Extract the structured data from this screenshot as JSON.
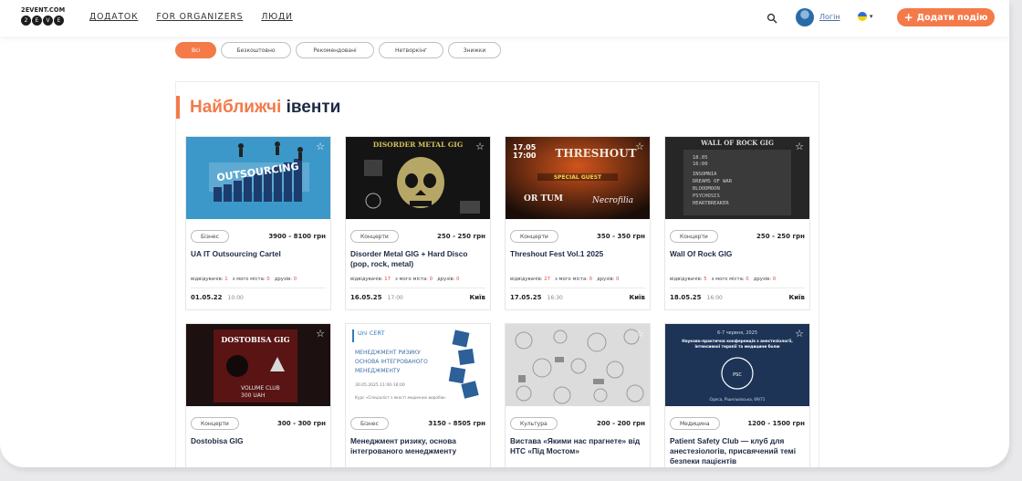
{
  "header": {
    "logo_text": "2EVENT.COM",
    "logo_dots": [
      "2",
      "E",
      "V",
      "E"
    ],
    "nav": [
      "ДОДАТОК",
      "FOR ORGANIZERS",
      "ЛЮДИ"
    ],
    "login": "Логін",
    "add_event": "Додати подію",
    "add_icon": "plus-icon"
  },
  "filters": [
    "Всі",
    "Безкоштовно",
    "Рекомендовані",
    "Нетворкінг",
    "Знижки"
  ],
  "section": {
    "title_highlight": "Найближчі",
    "title_rest": " івенти"
  },
  "stats_labels": {
    "attending": "відвідувачів:",
    "city": "з мого міста:",
    "friends": "друзів:"
  },
  "cards": [
    {
      "tag": "Бізнес",
      "price": "3900 - 8100 грн",
      "name": "UA IT Outsourcing Cartel",
      "attending": "1",
      "from_city": "0",
      "friends": "0",
      "date": "01.05.22",
      "time": "10:00",
      "city": "",
      "image_text": "OUTSOURCING",
      "image_bg": "#3b98c9"
    },
    {
      "tag": "Концерти",
      "price": "250 - 250 грн",
      "name": "Disorder Metal GIG + Hard Disco (pop, rock, metal)",
      "attending": "17",
      "from_city": "0",
      "friends": "0",
      "date": "16.05.25",
      "time": "17:00",
      "city": "Київ",
      "image_text": "DISORDER METAL GIG",
      "image_bg": "#141414"
    },
    {
      "tag": "Концерти",
      "price": "350 - 350 грн",
      "name": "Threshout Fest Vol.1 2025",
      "attending": "27",
      "from_city": "0",
      "friends": "0",
      "date": "17.05.25",
      "time": "16:30",
      "city": "Київ",
      "image_text": "THRESHOUT",
      "image_bg": "#2a1a14"
    },
    {
      "tag": "Концерти",
      "price": "250 - 250 грн",
      "name": "Wall Of Rock GIG",
      "attending": "5",
      "from_city": "0",
      "friends": "0",
      "date": "18.05.25",
      "time": "16:00",
      "city": "Київ",
      "image_text": "WALL OF ROCK GIG",
      "image_bg": "#262626"
    },
    {
      "tag": "Концерти",
      "price": "300 - 300 грн",
      "name": "Dostobisa GIG",
      "image_text": "DOSTOBISA GIG",
      "image_bg": "#1c1010"
    },
    {
      "tag": "Бізнес",
      "price": "3150 - 8505 грн",
      "name": "Менеджмент ризику, основа інтегрованого менеджменту",
      "image_text": "МЕНЕДЖМЕНТ РИЗИКУ ОСНОВА ІНТЕГРОВАНОГО МЕНЕДЖМЕНТУ",
      "image_sub": "Uni CERT",
      "image_bg": "#ffffff"
    },
    {
      "tag": "Культура",
      "price": "200 - 200 грн",
      "name": "Вистава «Якими нас прагнете» від НТС «Під Мостом»",
      "image_text": "",
      "image_bg": "#dcdcdc"
    },
    {
      "tag": "Медицина",
      "price": "1200 - 1500 грн",
      "name": "Patient Safety Club — клуб для анестезіологів, присвячений темі безпеки пацієнтів",
      "image_text": "Patient Safety Club",
      "image_bg": "#1d3457"
    }
  ],
  "colors": {
    "accent": "#f47a4a",
    "title": "#1e2a44",
    "stat_value": "#e0433a"
  }
}
